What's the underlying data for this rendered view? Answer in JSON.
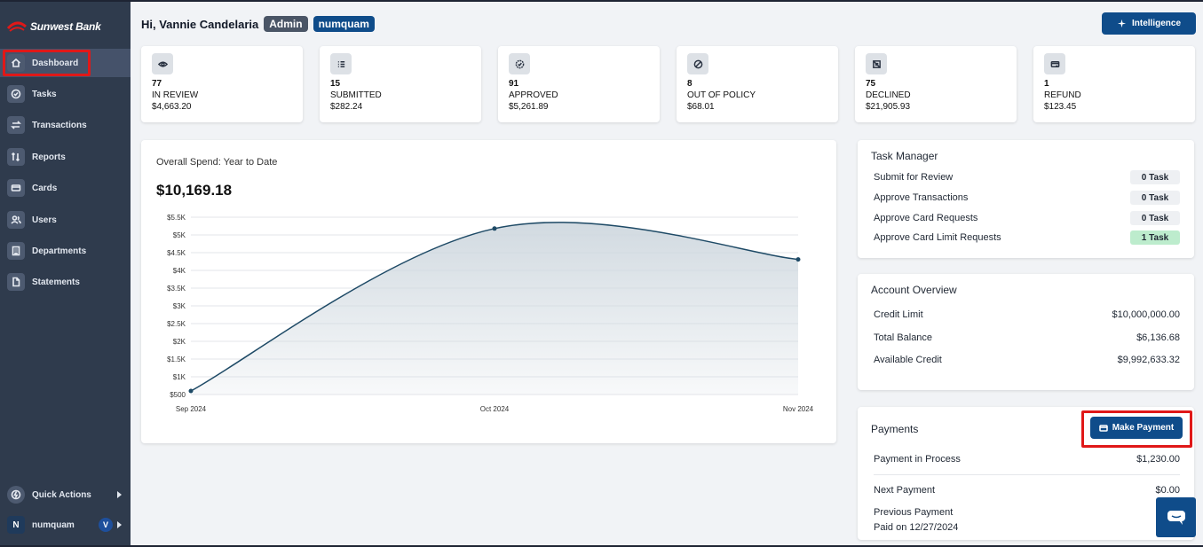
{
  "brand": {
    "name": "Sunwest Bank"
  },
  "sidebar": {
    "items": [
      {
        "label": "Dashboard",
        "icon": "home-icon"
      },
      {
        "label": "Tasks",
        "icon": "check-circle-icon"
      },
      {
        "label": "Transactions",
        "icon": "arrows-icon"
      },
      {
        "label": "Reports",
        "icon": "reports-icon"
      },
      {
        "label": "Cards",
        "icon": "card-icon"
      },
      {
        "label": "Users",
        "icon": "users-icon"
      },
      {
        "label": "Departments",
        "icon": "building-icon"
      },
      {
        "label": "Statements",
        "icon": "document-icon"
      }
    ],
    "quick_actions": "Quick Actions",
    "user": {
      "initial": "N",
      "name": "numquam",
      "badge": "V"
    }
  },
  "header": {
    "greeting": "Hi, Vannie Candelaria",
    "role": "Admin",
    "org": "numquam",
    "intelligence_label": "Intelligence"
  },
  "stats": [
    {
      "count": "77",
      "label": "IN REVIEW",
      "amount": "$4,663.20",
      "icon": "eye-icon"
    },
    {
      "count": "15",
      "label": "SUBMITTED",
      "amount": "$282.24",
      "icon": "list-icon"
    },
    {
      "count": "91",
      "label": "APPROVED",
      "amount": "$5,261.89",
      "icon": "approved-icon"
    },
    {
      "count": "8",
      "label": "OUT OF POLICY",
      "amount": "$68.01",
      "icon": "ban-icon"
    },
    {
      "count": "75",
      "label": "DECLINED",
      "amount": "$21,905.93",
      "icon": "declined-icon"
    },
    {
      "count": "1",
      "label": "REFUND",
      "amount": "$123.45",
      "icon": "refund-icon"
    }
  ],
  "chart": {
    "title": "Overall Spend: Year to Date",
    "total": "$10,169.18"
  },
  "chart_data": {
    "type": "area",
    "categories": [
      "Sep 2024",
      "Oct 2024",
      "Nov 2024"
    ],
    "values": [
      600,
      5180,
      4310
    ],
    "y_ticks": [
      "$500",
      "$1K",
      "$1.5K",
      "$2K",
      "$2.5K",
      "$3K",
      "$3.5K",
      "$4K",
      "$4.5K",
      "$5K",
      "$5.5K"
    ],
    "ylim": [
      500,
      5500
    ],
    "grid": true,
    "colors": {
      "line": "#1e4a66",
      "fill": "#cfd8df"
    }
  },
  "task_manager": {
    "title": "Task Manager",
    "rows": [
      {
        "label": "Submit for Review",
        "value": "0 Task"
      },
      {
        "label": "Approve Transactions",
        "value": "0 Task"
      },
      {
        "label": "Approve Card Requests",
        "value": "0 Task"
      },
      {
        "label": "Approve Card Limit Requests",
        "value": "1 Task"
      }
    ]
  },
  "account_overview": {
    "title": "Account Overview",
    "rows": [
      {
        "label": "Credit Limit",
        "value": "$10,000,000.00"
      },
      {
        "label": "Total Balance",
        "value": "$6,136.68"
      },
      {
        "label": "Available Credit",
        "value": "$9,992,633.32"
      }
    ]
  },
  "payments": {
    "title": "Payments",
    "make_payment_label": "Make Payment",
    "in_process_label": "Payment in Process",
    "in_process_value": "$1,230.00",
    "next_label": "Next Payment",
    "next_value": "$0.00",
    "previous_label": "Previous Payment",
    "previous_date": "Paid on 12/27/2024"
  }
}
